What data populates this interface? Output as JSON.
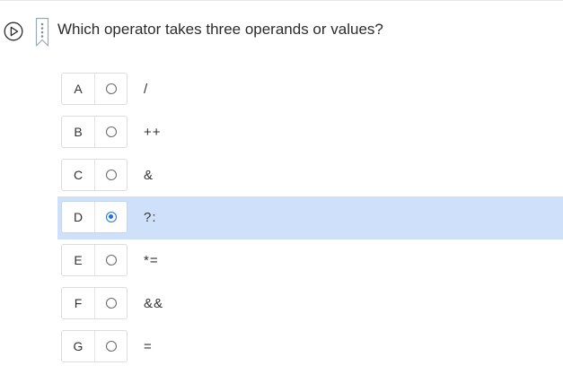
{
  "question": {
    "text": "Which operator takes three operands or values?"
  },
  "icons": {
    "play": "play-circle-icon",
    "bookmark": "bookmark-icon"
  },
  "colors": {
    "selected_row": "#cfe0fb",
    "radio_accent": "#1a73e8"
  },
  "options": [
    {
      "letter": "A",
      "text": "/",
      "selected": false
    },
    {
      "letter": "B",
      "text": "++",
      "selected": false
    },
    {
      "letter": "C",
      "text": "&",
      "selected": false
    },
    {
      "letter": "D",
      "text": "?:",
      "selected": true
    },
    {
      "letter": "E",
      "text": "*=",
      "selected": false
    },
    {
      "letter": "F",
      "text": "&&",
      "selected": false
    },
    {
      "letter": "G",
      "text": "=",
      "selected": false
    }
  ]
}
